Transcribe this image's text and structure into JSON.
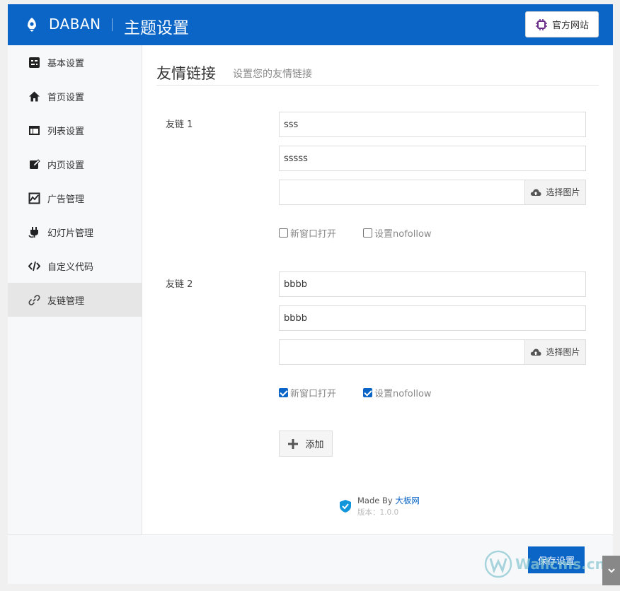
{
  "header": {
    "brand": "DABAN",
    "title": "主题设置",
    "site_button": "官方网站",
    "logo_icon": "rocket-icon",
    "site_icon": "chip-icon"
  },
  "sidebar": {
    "items": [
      {
        "label": "基本设置",
        "icon": "settings-panel-icon"
      },
      {
        "label": "首页设置",
        "icon": "home-icon"
      },
      {
        "label": "列表设置",
        "icon": "layout-icon"
      },
      {
        "label": "内页设置",
        "icon": "edit-icon"
      },
      {
        "label": "广告管理",
        "icon": "chart-icon"
      },
      {
        "label": "幻灯片管理",
        "icon": "plug-icon"
      },
      {
        "label": "自定义代码",
        "icon": "code-icon"
      },
      {
        "label": "友链管理",
        "icon": "link-icon",
        "active": true
      }
    ]
  },
  "section": {
    "title": "友情链接",
    "subtitle": "设置您的友情链接"
  },
  "links": [
    {
      "label": "友链 1",
      "name": "sss",
      "url": "sssss",
      "image": "",
      "upload_label": "选择图片",
      "new_window_label": "新窗口打开",
      "new_window": false,
      "nofollow_label": "设置nofollow",
      "nofollow": false
    },
    {
      "label": "友链 2",
      "name": "bbbb",
      "url": "bbbb",
      "image": "",
      "upload_label": "选择图片",
      "new_window_label": "新窗口打开",
      "new_window": true,
      "nofollow_label": "设置nofollow",
      "nofollow": true
    }
  ],
  "add_button": "添加",
  "madeby": {
    "prefix": "Made By",
    "author": "大板网",
    "version": "版本：1.0.0"
  },
  "footer": {
    "save_button": "保存设置"
  },
  "watermark": "Wallcms.cn",
  "colors": {
    "primary": "#0b65c6",
    "sidebar_bg": "#f7f8fa",
    "active_bg": "#e6e6e6"
  }
}
